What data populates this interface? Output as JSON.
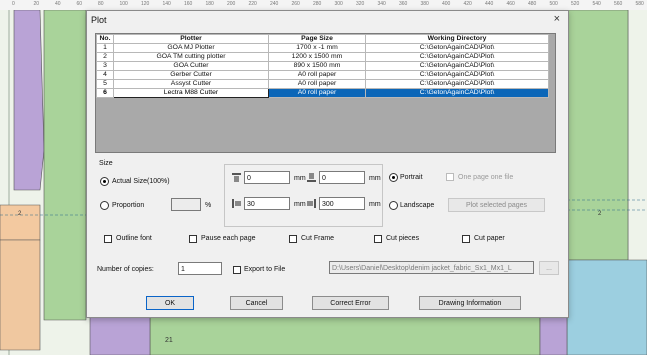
{
  "ruler": {
    "ticks": [
      "0",
      "20",
      "40",
      "60",
      "80",
      "100",
      "120",
      "140",
      "160",
      "180",
      "200",
      "220",
      "240",
      "260",
      "280",
      "300",
      "320",
      "340",
      "360",
      "380",
      "400",
      "420",
      "440",
      "460",
      "480",
      "500",
      "520",
      "540",
      "560",
      "580"
    ]
  },
  "canvas_labels": {
    "label_1": "2",
    "label_2": "2",
    "label_3": "21"
  },
  "dialog": {
    "title": "Plot",
    "close_symbol": "×",
    "table": {
      "headers": [
        "No.",
        "Plotter",
        "Page Size",
        "Working Directory"
      ],
      "rows": [
        {
          "no": "1",
          "plotter": "GOA MJ Plotter",
          "size": "1700 x -1 mm",
          "dir": "C:\\GetonAgainCAD\\Plot\\"
        },
        {
          "no": "2",
          "plotter": "GOA TM cutting plotter",
          "size": "1200 x 1500 mm",
          "dir": "C:\\GetonAgainCAD\\Plot\\"
        },
        {
          "no": "3",
          "plotter": "GOA Cutter",
          "size": "890 x 1500 mm",
          "dir": "C:\\GetonAgainCAD\\Plot\\"
        },
        {
          "no": "4",
          "plotter": "Gerber Cutter",
          "size": "A0 roll paper",
          "dir": "C:\\GetonAgainCAD\\Plot\\"
        },
        {
          "no": "5",
          "plotter": "Assyst Cutter",
          "size": "A0 roll paper",
          "dir": "C:\\GetonAgainCAD\\Plot\\"
        },
        {
          "no": "6",
          "plotter": "Lectra M88 Cutter",
          "size": "A0 roll paper",
          "dir": "C:\\GetonAgainCAD\\Plot\\"
        }
      ]
    },
    "size": {
      "label": "Size",
      "actual_size": "Actual Size(100%)",
      "proportion": "Proportion",
      "proportion_value": "",
      "percent": "%"
    },
    "dims": {
      "x_offset": "0",
      "y_offset": "0",
      "x_margin": "30",
      "y_margin": "300",
      "unit_mm": "mm"
    },
    "orientation": {
      "portrait": "Portrait",
      "landscape": "Landscape",
      "one_page_one_file": "One page one file",
      "plot_selected_pages": "Plot selected pages"
    },
    "options": {
      "outline_font": "Outline font",
      "pause_each_page": "Pause each page",
      "cut_frame": "Cut Frame",
      "cut_pieces": "Cut pieces",
      "cut_paper": "Cut paper"
    },
    "copies": {
      "label": "Number of copies:",
      "value": "1",
      "export_to_file": "Export to File",
      "file_path": "D:\\Users\\Daniel\\Desktop\\denim jacket_fabric_Sx1_Mx1_L",
      "browse": "..."
    },
    "buttons": {
      "ok": "OK",
      "cancel": "Cancel",
      "correct_error": "Correct Error",
      "drawing_information": "Drawing Information"
    }
  }
}
